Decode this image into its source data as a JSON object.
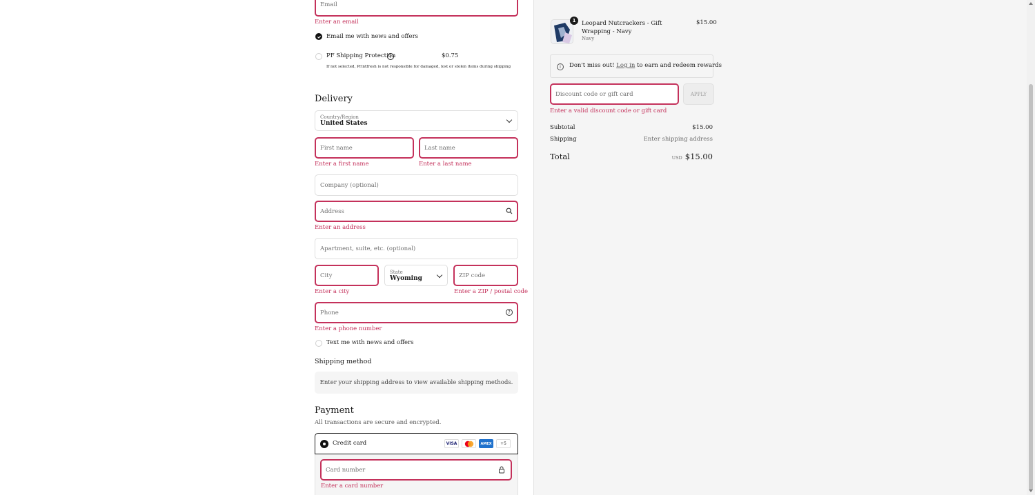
{
  "contact": {
    "email_placeholder": "Email",
    "email_error": "Enter an email",
    "news_checkbox_label": "Email me with news and offers",
    "protection_label": "PF Shipping Protection",
    "protection_price": "$0.75",
    "protection_note": "If not selected, Printfresh is not responsible for damaged, lost or stolen items during shipping"
  },
  "delivery": {
    "heading": "Delivery",
    "country_label": "Country/Region",
    "country_value": "United States",
    "first_name_placeholder": "First name",
    "first_name_error": "Enter a first name",
    "last_name_placeholder": "Last name",
    "last_name_error": "Enter a last name",
    "company_placeholder": "Company (optional)",
    "address_placeholder": "Address",
    "address_error": "Enter an address",
    "apartment_placeholder": "Apartment, suite, etc. (optional)",
    "city_placeholder": "City",
    "city_error": "Enter a city",
    "state_label": "State",
    "state_value": "Wyoming",
    "zip_placeholder": "ZIP code",
    "zip_error": "Enter a ZIP / postal code",
    "phone_placeholder": "Phone",
    "phone_error": "Enter a phone number",
    "text_checkbox_label": "Text me with news and offers"
  },
  "shipping_method": {
    "heading": "Shipping method",
    "notice": "Enter your shipping address to view available shipping methods."
  },
  "payment": {
    "heading": "Payment",
    "subtitle": "All transactions are secure and encrypted.",
    "credit_card_label": "Credit card",
    "card_logos": [
      "VISA",
      "MC",
      "AMEX"
    ],
    "more_cards": "+5",
    "card_number_placeholder": "Card number",
    "card_number_error": "Enter a card number"
  },
  "summary": {
    "item_name": "Leopard Nutcrackers - Gift Wrapping - Navy",
    "item_variant": "Navy",
    "item_qty": "1",
    "item_price": "$15.00",
    "rewards_prefix": "Don't miss out!",
    "rewards_link": "Log in",
    "rewards_suffix": "to earn and redeem rewards",
    "discount_placeholder": "Discount code or gift card",
    "apply_label": "APPLY",
    "discount_error": "Enter a valid discount code or gift card",
    "subtotal_label": "Subtotal",
    "subtotal_value": "$15.00",
    "shipping_label": "Shipping",
    "shipping_value": "Enter shipping address",
    "total_label": "Total",
    "total_currency": "USD",
    "total_value": "$15.00"
  },
  "colors": {
    "error": "#c4315b",
    "summary_bg": "#f5f5f5"
  }
}
